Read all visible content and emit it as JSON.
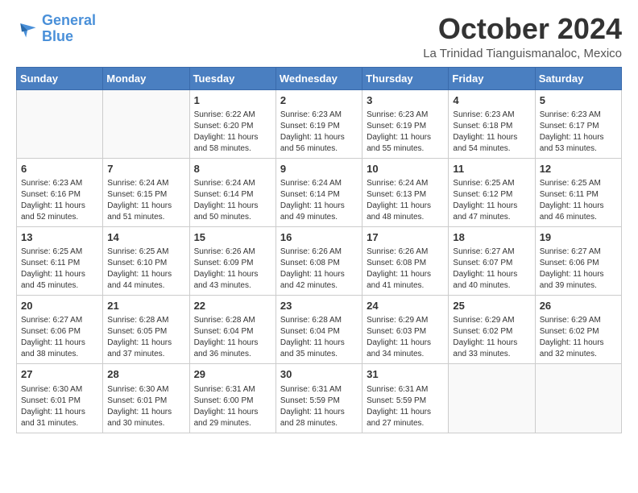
{
  "header": {
    "logo_line1": "General",
    "logo_line2": "Blue",
    "month_title": "October 2024",
    "location": "La Trinidad Tianguismanaloc, Mexico"
  },
  "days_of_week": [
    "Sunday",
    "Monday",
    "Tuesday",
    "Wednesday",
    "Thursday",
    "Friday",
    "Saturday"
  ],
  "weeks": [
    [
      {
        "day": "",
        "empty": true
      },
      {
        "day": "",
        "empty": true
      },
      {
        "day": "1",
        "sunrise": "6:22 AM",
        "sunset": "6:20 PM",
        "daylight": "11 hours and 58 minutes."
      },
      {
        "day": "2",
        "sunrise": "6:23 AM",
        "sunset": "6:19 PM",
        "daylight": "11 hours and 56 minutes."
      },
      {
        "day": "3",
        "sunrise": "6:23 AM",
        "sunset": "6:19 PM",
        "daylight": "11 hours and 55 minutes."
      },
      {
        "day": "4",
        "sunrise": "6:23 AM",
        "sunset": "6:18 PM",
        "daylight": "11 hours and 54 minutes."
      },
      {
        "day": "5",
        "sunrise": "6:23 AM",
        "sunset": "6:17 PM",
        "daylight": "11 hours and 53 minutes."
      }
    ],
    [
      {
        "day": "6",
        "sunrise": "6:23 AM",
        "sunset": "6:16 PM",
        "daylight": "11 hours and 52 minutes."
      },
      {
        "day": "7",
        "sunrise": "6:24 AM",
        "sunset": "6:15 PM",
        "daylight": "11 hours and 51 minutes."
      },
      {
        "day": "8",
        "sunrise": "6:24 AM",
        "sunset": "6:14 PM",
        "daylight": "11 hours and 50 minutes."
      },
      {
        "day": "9",
        "sunrise": "6:24 AM",
        "sunset": "6:14 PM",
        "daylight": "11 hours and 49 minutes."
      },
      {
        "day": "10",
        "sunrise": "6:24 AM",
        "sunset": "6:13 PM",
        "daylight": "11 hours and 48 minutes."
      },
      {
        "day": "11",
        "sunrise": "6:25 AM",
        "sunset": "6:12 PM",
        "daylight": "11 hours and 47 minutes."
      },
      {
        "day": "12",
        "sunrise": "6:25 AM",
        "sunset": "6:11 PM",
        "daylight": "11 hours and 46 minutes."
      }
    ],
    [
      {
        "day": "13",
        "sunrise": "6:25 AM",
        "sunset": "6:11 PM",
        "daylight": "11 hours and 45 minutes."
      },
      {
        "day": "14",
        "sunrise": "6:25 AM",
        "sunset": "6:10 PM",
        "daylight": "11 hours and 44 minutes."
      },
      {
        "day": "15",
        "sunrise": "6:26 AM",
        "sunset": "6:09 PM",
        "daylight": "11 hours and 43 minutes."
      },
      {
        "day": "16",
        "sunrise": "6:26 AM",
        "sunset": "6:08 PM",
        "daylight": "11 hours and 42 minutes."
      },
      {
        "day": "17",
        "sunrise": "6:26 AM",
        "sunset": "6:08 PM",
        "daylight": "11 hours and 41 minutes."
      },
      {
        "day": "18",
        "sunrise": "6:27 AM",
        "sunset": "6:07 PM",
        "daylight": "11 hours and 40 minutes."
      },
      {
        "day": "19",
        "sunrise": "6:27 AM",
        "sunset": "6:06 PM",
        "daylight": "11 hours and 39 minutes."
      }
    ],
    [
      {
        "day": "20",
        "sunrise": "6:27 AM",
        "sunset": "6:06 PM",
        "daylight": "11 hours and 38 minutes."
      },
      {
        "day": "21",
        "sunrise": "6:28 AM",
        "sunset": "6:05 PM",
        "daylight": "11 hours and 37 minutes."
      },
      {
        "day": "22",
        "sunrise": "6:28 AM",
        "sunset": "6:04 PM",
        "daylight": "11 hours and 36 minutes."
      },
      {
        "day": "23",
        "sunrise": "6:28 AM",
        "sunset": "6:04 PM",
        "daylight": "11 hours and 35 minutes."
      },
      {
        "day": "24",
        "sunrise": "6:29 AM",
        "sunset": "6:03 PM",
        "daylight": "11 hours and 34 minutes."
      },
      {
        "day": "25",
        "sunrise": "6:29 AM",
        "sunset": "6:02 PM",
        "daylight": "11 hours and 33 minutes."
      },
      {
        "day": "26",
        "sunrise": "6:29 AM",
        "sunset": "6:02 PM",
        "daylight": "11 hours and 32 minutes."
      }
    ],
    [
      {
        "day": "27",
        "sunrise": "6:30 AM",
        "sunset": "6:01 PM",
        "daylight": "11 hours and 31 minutes."
      },
      {
        "day": "28",
        "sunrise": "6:30 AM",
        "sunset": "6:01 PM",
        "daylight": "11 hours and 30 minutes."
      },
      {
        "day": "29",
        "sunrise": "6:31 AM",
        "sunset": "6:00 PM",
        "daylight": "11 hours and 29 minutes."
      },
      {
        "day": "30",
        "sunrise": "6:31 AM",
        "sunset": "5:59 PM",
        "daylight": "11 hours and 28 minutes."
      },
      {
        "day": "31",
        "sunrise": "6:31 AM",
        "sunset": "5:59 PM",
        "daylight": "11 hours and 27 minutes."
      },
      {
        "day": "",
        "empty": true
      },
      {
        "day": "",
        "empty": true
      }
    ]
  ],
  "labels": {
    "sunrise": "Sunrise:",
    "sunset": "Sunset:",
    "daylight": "Daylight:"
  }
}
